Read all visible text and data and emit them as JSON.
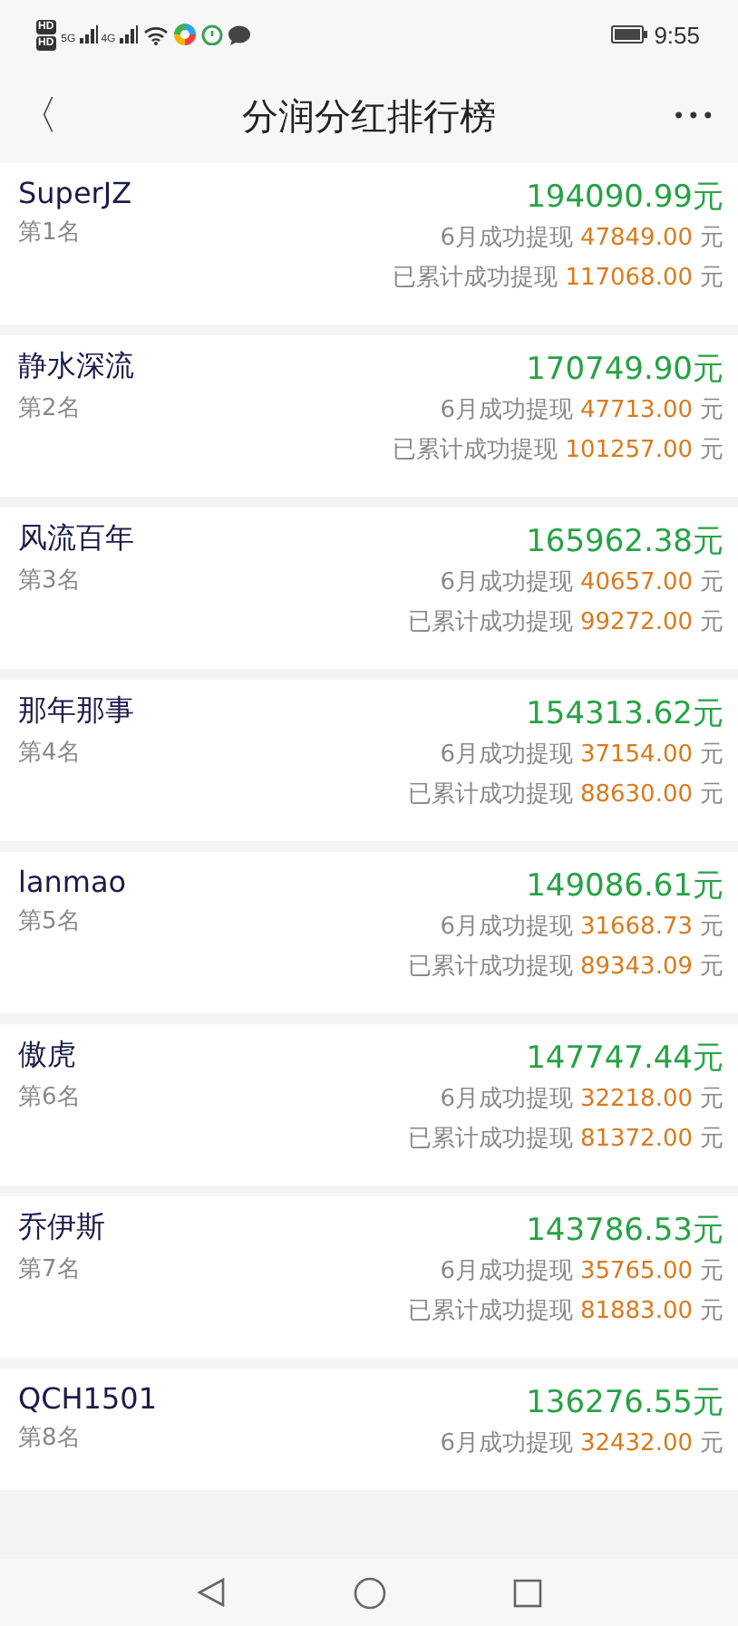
{
  "status_bar": {
    "badges": [
      "HD",
      "HD"
    ],
    "networks": [
      "5G",
      "4G"
    ],
    "time": "9:55"
  },
  "header": {
    "back": "〈",
    "title": "分润分红排行榜",
    "more": "•••"
  },
  "rows": [
    {
      "name": "SuperJZ",
      "rank": "第1名",
      "total": "194090.99元",
      "monthly": {
        "label": "6月成功提现",
        "amount": "47849.00",
        "unit": "元"
      },
      "cumulative": {
        "label": "已累计成功提现",
        "amount": "117068.00",
        "unit": "元"
      }
    },
    {
      "name": "静水深流",
      "rank": "第2名",
      "total": "170749.90元",
      "monthly": {
        "label": "6月成功提现",
        "amount": "47713.00",
        "unit": "元"
      },
      "cumulative": {
        "label": "已累计成功提现",
        "amount": "101257.00",
        "unit": "元"
      }
    },
    {
      "name": "风流百年",
      "rank": "第3名",
      "total": "165962.38元",
      "monthly": {
        "label": "6月成功提现",
        "amount": "40657.00",
        "unit": "元"
      },
      "cumulative": {
        "label": "已累计成功提现",
        "amount": "99272.00",
        "unit": "元"
      }
    },
    {
      "name": "那年那事",
      "rank": "第4名",
      "total": "154313.62元",
      "monthly": {
        "label": "6月成功提现",
        "amount": "37154.00",
        "unit": "元"
      },
      "cumulative": {
        "label": "已累计成功提现",
        "amount": "88630.00",
        "unit": "元"
      }
    },
    {
      "name": "lanmao",
      "rank": "第5名",
      "total": "149086.61元",
      "monthly": {
        "label": "6月成功提现",
        "amount": "31668.73",
        "unit": "元"
      },
      "cumulative": {
        "label": "已累计成功提现",
        "amount": "89343.09",
        "unit": "元"
      }
    },
    {
      "name": "傲虎",
      "rank": "第6名",
      "total": "147747.44元",
      "monthly": {
        "label": "6月成功提现",
        "amount": "32218.00",
        "unit": "元"
      },
      "cumulative": {
        "label": "已累计成功提现",
        "amount": "81372.00",
        "unit": "元"
      }
    },
    {
      "name": "乔伊斯",
      "rank": "第7名",
      "total": "143786.53元",
      "monthly": {
        "label": "6月成功提现",
        "amount": "35765.00",
        "unit": "元"
      },
      "cumulative": {
        "label": "已累计成功提现",
        "amount": "81883.00",
        "unit": "元"
      }
    },
    {
      "name": "QCH1501",
      "rank": "第8名",
      "total": "136276.55元",
      "monthly": {
        "label": "6月成功提现",
        "amount": "32432.00",
        "unit": "元"
      }
    }
  ]
}
